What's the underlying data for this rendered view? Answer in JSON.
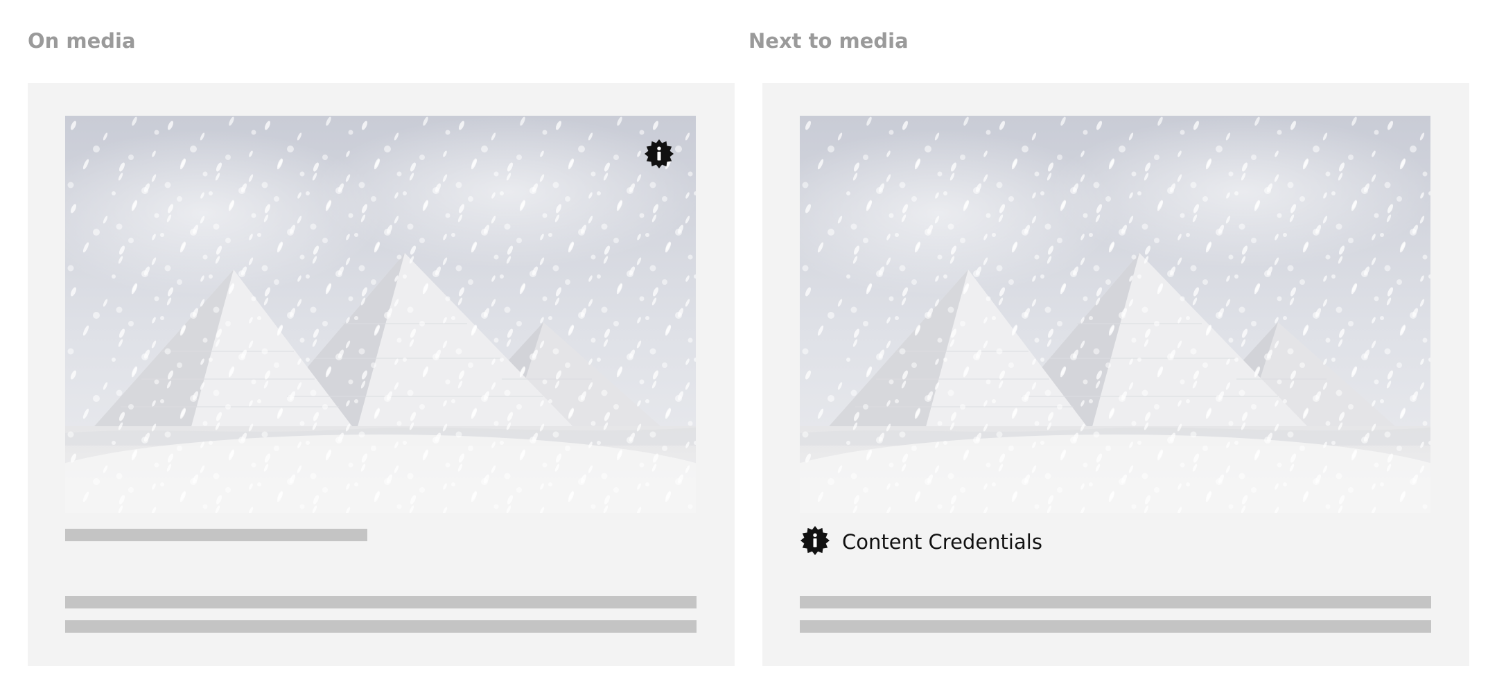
{
  "left_section": {
    "heading": "On media",
    "badge_icon": "content-credentials-icon",
    "image_subject": "snow-covered-pyramids"
  },
  "right_section": {
    "heading": "Next to media",
    "badge_icon": "content-credentials-icon",
    "badge_label": "Content Credentials",
    "image_subject": "snow-covered-pyramids"
  },
  "colors": {
    "page_background": "#ffffff",
    "panel_background": "#f3f3f3",
    "heading_text": "#9a9a9a",
    "placeholder_bar": "#c4c4c4",
    "badge": "#111111"
  }
}
